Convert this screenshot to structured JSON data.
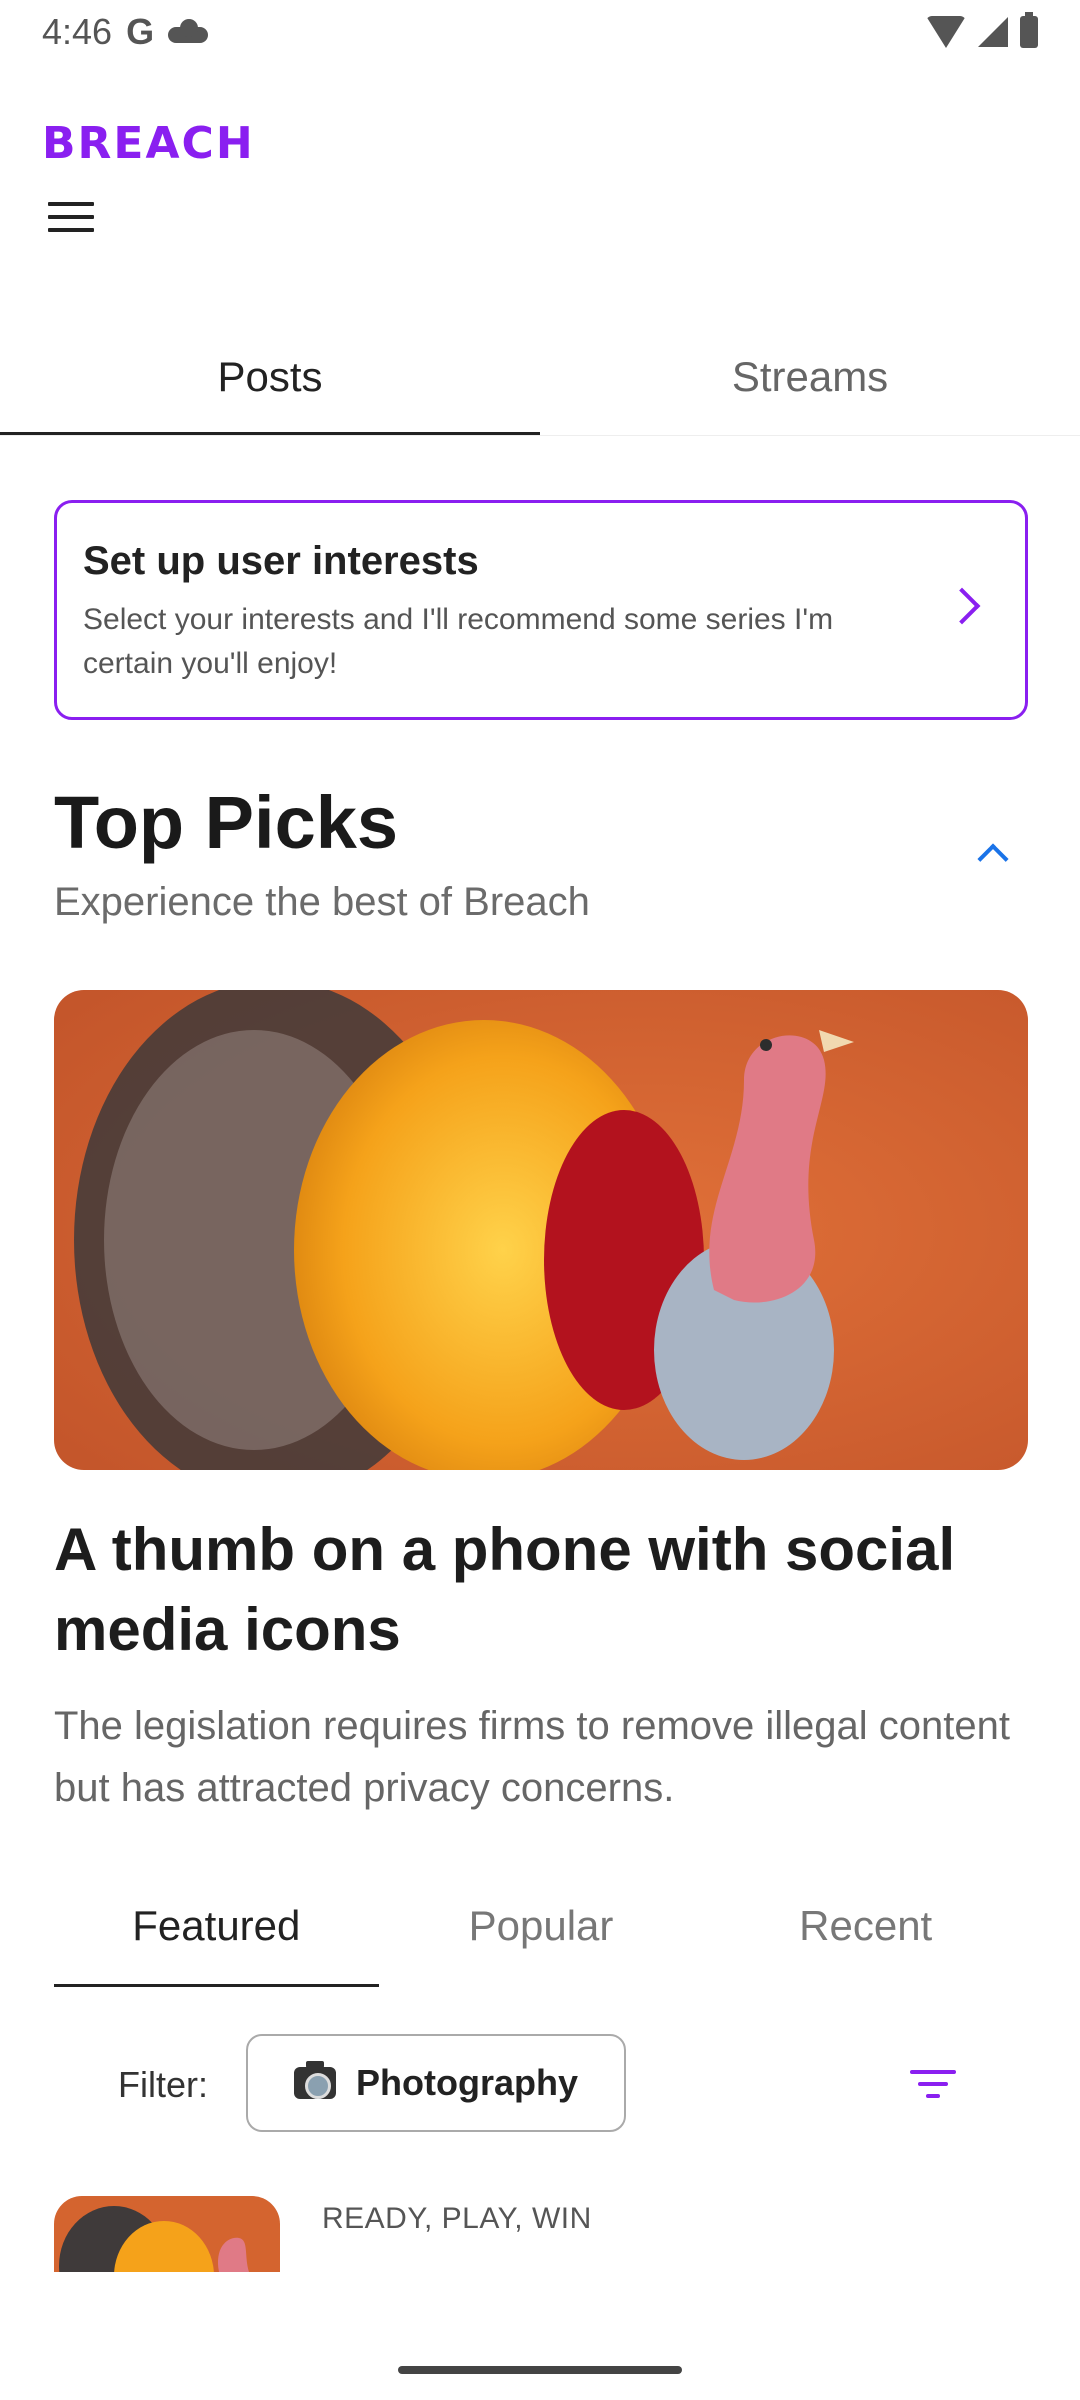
{
  "status_bar": {
    "time": "4:46",
    "google_glyph": "G",
    "icons": [
      "google-icon",
      "cloud-icon",
      "wifi-icon",
      "signal-icon",
      "battery-icon"
    ]
  },
  "app": {
    "logo": "BREACH",
    "brand_color": "#8a1ff0"
  },
  "top_tabs": [
    {
      "label": "Posts",
      "active": true
    },
    {
      "label": "Streams",
      "active": false
    }
  ],
  "interest_card": {
    "title": "Set up user interests",
    "description": "Select your interests and I'll recommend some series I'm certain you'll enjoy!"
  },
  "top_picks": {
    "title": "Top Picks",
    "subtitle": "Experience the best of Breach"
  },
  "featured_article": {
    "title": "A thumb on a phone with social media icons",
    "description": "The legislation requires firms to remove illegal content but has attracted privacy concerns."
  },
  "sub_tabs": [
    {
      "label": "Featured",
      "active": true
    },
    {
      "label": "Popular",
      "active": false
    },
    {
      "label": "Recent",
      "active": false
    }
  ],
  "filter": {
    "label": "Filter:",
    "chip": "Photography"
  },
  "list_item": {
    "eyebrow": "READY, PLAY, WIN"
  },
  "colors": {
    "accent": "#8a1ff0",
    "link_blue": "#1a73e8",
    "image_bg": "#d4642f"
  }
}
